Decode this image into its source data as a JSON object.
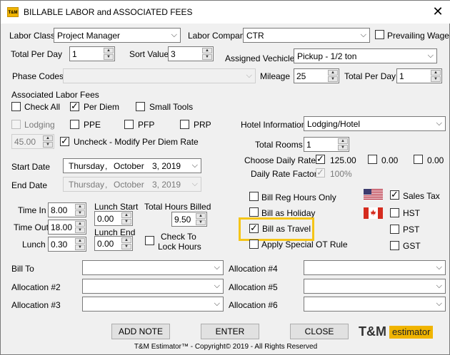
{
  "window": {
    "icon_text": "T&M",
    "title": "BILLABLE LABOR and ASSOCIATED FEES",
    "close_glyph": "✕"
  },
  "labor": {
    "labor_class_label": "Labor Class",
    "labor_class_value": "Project Manager",
    "labor_company_label": "Labor Company",
    "labor_company_value": "CTR",
    "prevailing_wage_label": "Prevailing Wage",
    "total_per_day_label": "Total Per Day",
    "total_per_day_value": "1",
    "sort_value_label": "Sort Value",
    "sort_value_value": "3",
    "assigned_vehicle_label": "Assigned Vechicle",
    "assigned_vehicle_value": "Pickup - 1/2 ton",
    "phase_codes_label": "Phase Codes",
    "phase_codes_value": "",
    "mileage_label": "Mileage",
    "mileage_value": "25",
    "vehicle_total_per_day_label": "Total Per Day",
    "vehicle_total_per_day_value": "1"
  },
  "fees": {
    "section_label": "Associated Labor Fees",
    "check_all": "Check All",
    "per_diem": "Per Diem",
    "small_tools": "Small Tools",
    "lodging": "Lodging",
    "ppe": "PPE",
    "pfp": "PFP",
    "prp": "PRP",
    "per_diem_rate": "45.00",
    "uncheck_modify": "Uncheck - Modify Per Diem Rate"
  },
  "hotel": {
    "hotel_info_label": "Hotel Information",
    "hotel_info_value": "Lodging/Hotel",
    "total_rooms_label": "Total Rooms",
    "total_rooms_value": "1",
    "choose_rate_label": "Choose Daily Rate",
    "rate1": "125.00",
    "rate2": "0.00",
    "rate3": "0.00",
    "daily_rate_factor_label": "Daily Rate Factor",
    "daily_rate_factor_value": "100%"
  },
  "dates": {
    "start_label": "Start Date",
    "start_weekday": "Thursday",
    "start_comma": ",",
    "start_month": "October",
    "start_day_year": "3, 2019",
    "end_label": "End Date",
    "end_weekday": "Thursday",
    "end_comma": ",",
    "end_month": "October",
    "end_day_year": "3, 2019"
  },
  "time": {
    "time_in_label": "Time In",
    "time_in_value": "8.00",
    "time_out_label": "Time Out",
    "time_out_value": "18.00",
    "lunch_label": "Lunch",
    "lunch_value": "0.30",
    "lunch_start_label": "Lunch Start",
    "lunch_start_value": "0.00",
    "lunch_end_label": "Lunch End",
    "lunch_end_value": "0.00",
    "total_hours_label": "Total Hours Billed",
    "total_hours_value": "9.50",
    "check_to_lock_line1": "Check To",
    "check_to_lock_line2": "Lock Hours"
  },
  "billing_options": {
    "bill_reg_hours": "Bill Reg Hours Only",
    "bill_as_holiday": "Bill as Holiday",
    "bill_as_travel": "Bill as Travel",
    "apply_special_ot": "Apply Special OT Rule"
  },
  "taxes": {
    "sales_tax": "Sales Tax",
    "hst": "HST",
    "pst": "PST",
    "gst": "GST"
  },
  "allocations": {
    "bill_to_label": "Bill To",
    "alloc2_label": "Allocation #2",
    "alloc3_label": "Allocation #3",
    "alloc4_label": "Allocation #4",
    "alloc5_label": "Allocation #5",
    "alloc6_label": "Allocation #6"
  },
  "buttons": {
    "add_note": "ADD NOTE",
    "enter": "ENTER",
    "close": "CLOSE"
  },
  "branding": {
    "logo_tm": "T&M",
    "logo_est": "estimator",
    "footer": "T&M Estimator™ - Copyright© 2019 - All Rights Reserved"
  },
  "glyphs": {
    "dropdown": "⌵",
    "check": "✓",
    "up": "▲",
    "down": "▼"
  },
  "colors": {
    "highlight": "#f5c518",
    "logo_accent": "#f0b400"
  }
}
